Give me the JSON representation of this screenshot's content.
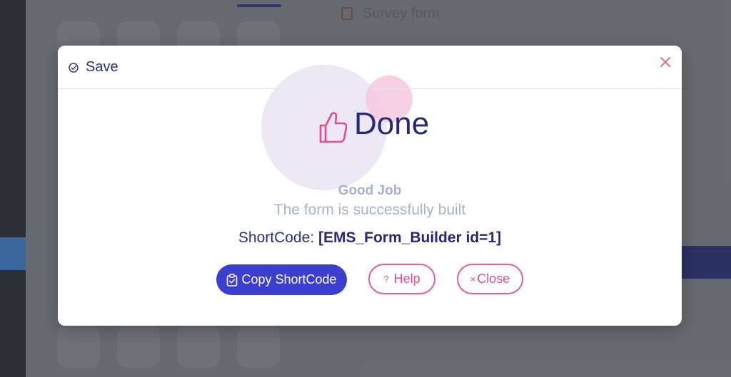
{
  "background": {
    "survey_title": "Survey form"
  },
  "modal": {
    "header_title": "Save",
    "status_title": "Done",
    "good_job": "Good Job",
    "message": "The form is successfully built",
    "shortcode_label": "ShortCode:",
    "shortcode_value": "[EMS_Form_Builder id=1]",
    "buttons": {
      "copy": "Copy ShortCode",
      "help": "Help",
      "close": "Close",
      "help_glyph": "?",
      "close_glyph": "×"
    }
  },
  "colors": {
    "primary": "#3a3fd0",
    "accent_pink": "#e75d9b",
    "title_navy": "#27297a",
    "muted": "#a9b1d2"
  },
  "icons": [
    "check-circle-icon",
    "close-icon",
    "thumbs-up-icon",
    "clipboard-check-icon"
  ]
}
